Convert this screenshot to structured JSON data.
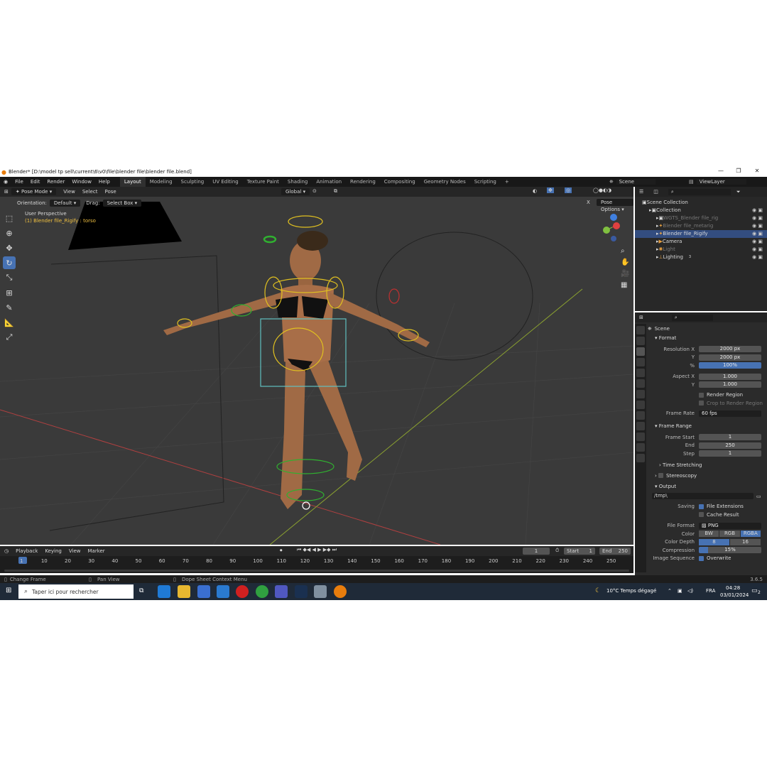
{
  "window": {
    "title": "Blender* [D:\\model tp sell\\current\\6\\v0\\file\\blender file\\blender file.blend]",
    "minimize": "—",
    "maximize": "❐",
    "close": "✕"
  },
  "menu": [
    "File",
    "Edit",
    "Render",
    "Window",
    "Help"
  ],
  "workspaces": [
    "Layout",
    "Modeling",
    "Sculpting",
    "UV Editing",
    "Texture Paint",
    "Shading",
    "Animation",
    "Rendering",
    "Compositing",
    "Geometry Nodes",
    "Scripting",
    "+"
  ],
  "active_workspace": "Layout",
  "scene_name": "Scene",
  "view_layer": "ViewLayer",
  "viewport_header": {
    "mode": "Pose Mode",
    "menus": [
      "View",
      "Select",
      "Pose"
    ],
    "transform_orientation": "Global",
    "orientation_label": "Orientation:",
    "orientation_value": "Default",
    "drag_label": "Drag:",
    "drag_value": "Select Box",
    "pose_options": "Pose Options",
    "x_mirror": "X"
  },
  "viewport_overlay": {
    "perspective": "User Perspective",
    "active": "(1) Blender file_Rigify : torso"
  },
  "outliner": {
    "items": [
      {
        "label": "Scene Collection",
        "indent": 0,
        "icon": "collection-icon",
        "selected": false
      },
      {
        "label": "Collection",
        "indent": 1,
        "icon": "collection-icon",
        "selected": false
      },
      {
        "label": "WGTS_Blender file_rig",
        "indent": 2,
        "icon": "collection-icon",
        "selected": false,
        "dim": true
      },
      {
        "label": "Blender file_metarig",
        "indent": 2,
        "icon": "armature-icon",
        "selected": false,
        "dim": true
      },
      {
        "label": "Blender file_Rigify",
        "indent": 2,
        "icon": "armature-icon",
        "selected": true
      },
      {
        "label": "Camera",
        "indent": 2,
        "icon": "camera-icon",
        "selected": false
      },
      {
        "label": "Light",
        "indent": 2,
        "icon": "light-icon",
        "selected": false,
        "dim": true
      },
      {
        "label": "Lighting",
        "indent": 2,
        "icon": "empty-icon",
        "selected": false
      }
    ],
    "lighting_badge": "3"
  },
  "properties": {
    "context": "Scene",
    "format_title": "Format",
    "resolution_x_label": "Resolution X",
    "resolution_x": "2000 px",
    "resolution_y_label": "Y",
    "resolution_y": "2000 px",
    "percent_label": "%",
    "percent": "100%",
    "aspect_x_label": "Aspect X",
    "aspect_x": "1.000",
    "aspect_y_label": "Y",
    "aspect_y": "1.000",
    "render_region": "Render Region",
    "crop_region": "Crop to Render Region",
    "frame_rate_label": "Frame Rate",
    "frame_rate": "60 fps",
    "frame_range_title": "Frame Range",
    "frame_start_label": "Frame Start",
    "frame_start": "1",
    "end_label": "End",
    "end": "250",
    "step_label": "Step",
    "step": "1",
    "time_stretching": "Time Stretching",
    "stereoscopy": "Stereoscopy",
    "output_title": "Output",
    "output_path": "/tmp\\",
    "saving_label": "Saving",
    "file_extensions": "File Extensions",
    "cache_result": "Cache Result",
    "file_format_label": "File Format",
    "file_format": "PNG",
    "color_label": "Color",
    "color_options": [
      "BW",
      "RGB",
      "RGBA"
    ],
    "color_selected": "RGBA",
    "color_depth_label": "Color Depth",
    "color_depth_options": [
      "8",
      "16"
    ],
    "color_depth_selected": "8",
    "compression_label": "Compression",
    "compression": "15%",
    "image_sequence_label": "Image Sequence",
    "overwrite": "Overwrite"
  },
  "timeline": {
    "menus": [
      "Playback",
      "Keying",
      "View",
      "Marker"
    ],
    "current_frame": "1",
    "start_label": "Start",
    "start": "1",
    "end_label": "End",
    "end": "250",
    "ticks": [
      "1",
      "10",
      "20",
      "30",
      "40",
      "50",
      "60",
      "70",
      "80",
      "90",
      "100",
      "110",
      "120",
      "130",
      "140",
      "150",
      "160",
      "170",
      "180",
      "190",
      "200",
      "210",
      "220",
      "230",
      "240",
      "250"
    ]
  },
  "statusbar": {
    "left": "Change Frame",
    "middle": "Pan View",
    "right": "Dope Sheet Context Menu",
    "version": "3.6.5"
  },
  "taskbar": {
    "search_placeholder": "Taper ici pour rechercher",
    "weather": "10°C  Temps dégagé",
    "lang": "FRA",
    "time": "04:28",
    "date": "03/01/2024",
    "notif": "2"
  },
  "colors": {
    "accent": "#4772b3",
    "bone_yellow": "#e0c020",
    "bone_green": "#30b030",
    "bone_red": "#c03030",
    "bone_cyan": "#60c0c0"
  }
}
